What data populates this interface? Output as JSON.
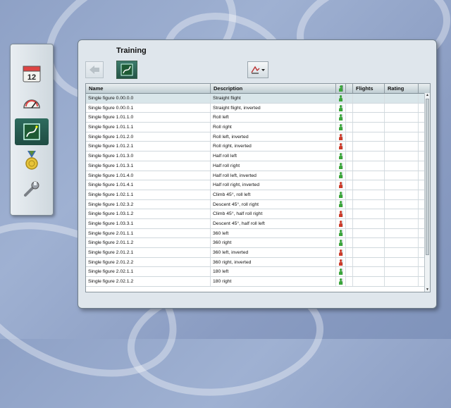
{
  "panel": {
    "title": "Training"
  },
  "sidebar": {
    "items": [
      {
        "name": "calendar",
        "icon": "calendar-icon",
        "number": "12"
      },
      {
        "name": "gauge",
        "icon": "gauge-icon"
      },
      {
        "name": "training",
        "icon": "training-chart-icon",
        "active": true
      },
      {
        "name": "medal",
        "icon": "medal-icon"
      },
      {
        "name": "tools",
        "icon": "wrench-icon"
      }
    ]
  },
  "toolbar": {
    "back_icon": "back-arrow-icon",
    "training_icon": "training-chart-icon",
    "filter_icon": "filter-dropdown-icon"
  },
  "table": {
    "headers": {
      "name": "Name",
      "description": "Description",
      "flights": "Flights",
      "rating": "Rating"
    },
    "rows": [
      {
        "name": "Single figure 0.00.0.0",
        "description": "Straight flight",
        "status": "green"
      },
      {
        "name": "Single figure 0.00.0.1",
        "description": "Straight flight, inverted",
        "status": "green"
      },
      {
        "name": "Single figure 1.01.1.0",
        "description": "Roll left",
        "status": "green"
      },
      {
        "name": "Single figure 1.01.1.1",
        "description": "Roll right",
        "status": "green"
      },
      {
        "name": "Single figure 1.01.2.0",
        "description": "Roll left, inverted",
        "status": "red"
      },
      {
        "name": "Single figure 1.01.2.1",
        "description": "Roll right, inverted",
        "status": "red"
      },
      {
        "name": "Single figure 1.01.3.0",
        "description": "Half roll left",
        "status": "green"
      },
      {
        "name": "Single figure 1.01.3.1",
        "description": "Half roll right",
        "status": "green"
      },
      {
        "name": "Single figure 1.01.4.0",
        "description": "Half roll left, inverted",
        "status": "green"
      },
      {
        "name": "Single figure 1.01.4.1",
        "description": "Half roll right, inverted",
        "status": "red"
      },
      {
        "name": "Single figure 1.02.1.1",
        "description": "Climb 45°, roll left",
        "status": "green"
      },
      {
        "name": "Single figure 1.02.3.2",
        "description": "Descent 45°, roll right",
        "status": "green"
      },
      {
        "name": "Single figure 1.03.1.2",
        "description": "Climb 45°, half roll right",
        "status": "red"
      },
      {
        "name": "Single figure 1.03.3.1",
        "description": "Descent 45°, half roll left",
        "status": "red"
      },
      {
        "name": "Single figure 2.01.1.1",
        "description": "360 left",
        "status": "green"
      },
      {
        "name": "Single figure 2.01.1.2",
        "description": "360 right",
        "status": "green"
      },
      {
        "name": "Single figure 2.01.2.1",
        "description": "360 left, inverted",
        "status": "red"
      },
      {
        "name": "Single figure 2.01.2.2",
        "description": "360 right, inverted",
        "status": "red"
      },
      {
        "name": "Single figure 2.02.1.1",
        "description": "180 left",
        "status": "green"
      },
      {
        "name": "Single figure 2.02.1.2",
        "description": "180 right",
        "status": "green"
      }
    ]
  },
  "colors": {
    "green": "#3aa53a",
    "red": "#cc3b2a",
    "accent": "#2e6b5e"
  }
}
